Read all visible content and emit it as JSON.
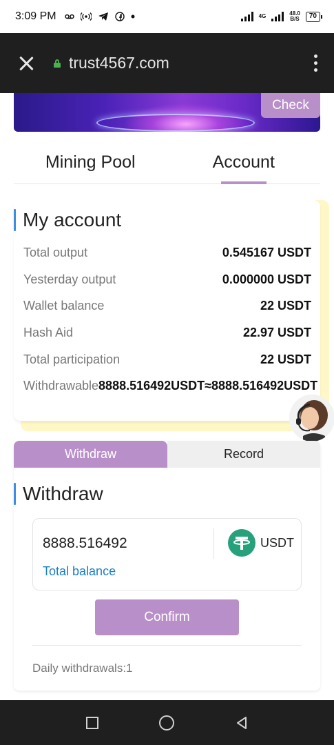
{
  "status_bar": {
    "time": "3:09 PM",
    "network": "4G",
    "speed_value": "48.0",
    "speed_unit": "B/S",
    "battery": "70"
  },
  "browser": {
    "url": "trust4567.com"
  },
  "banner": {
    "check_label": "Check"
  },
  "tabs": [
    {
      "label": "Mining Pool",
      "active": false
    },
    {
      "label": "Account",
      "active": true
    }
  ],
  "account": {
    "title": "My account",
    "rows": [
      {
        "label": "Total output",
        "value": "0.545167 USDT"
      },
      {
        "label": "Yesterday output",
        "value": "0.000000 USDT"
      },
      {
        "label": "Wallet balance",
        "value": "22 USDT"
      },
      {
        "label": "Hash Aid",
        "value": "22.97 USDT"
      },
      {
        "label": "Total participation",
        "value": "22 USDT"
      }
    ],
    "withdrawable_label": "Withdrawable",
    "withdrawable_value": "8888.516492USDT≈8888.516492USDT"
  },
  "withdraw": {
    "tabs": [
      {
        "label": "Withdraw",
        "active": true
      },
      {
        "label": "Record",
        "active": false
      }
    ],
    "title": "Withdraw",
    "amount": "8888.516492",
    "currency": "USDT",
    "total_balance_label": "Total balance",
    "confirm_label": "Confirm",
    "daily_withdrawals": "Daily withdrawals:1"
  },
  "colors": {
    "accent": "#b98fc9",
    "title_bar": "#3a8ee6",
    "link": "#1a7fc4",
    "usdt": "#26a17b",
    "dark_bar": "#1f1f1f"
  }
}
